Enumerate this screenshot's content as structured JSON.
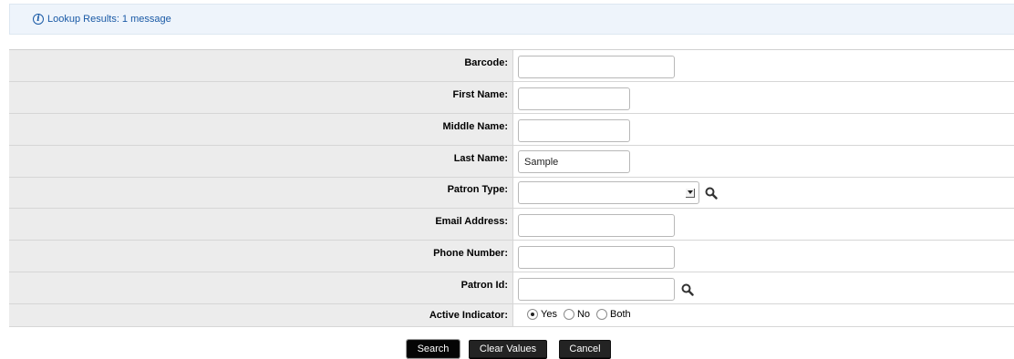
{
  "message": {
    "icon": "info-icon",
    "text": "Lookup Results: 1 message"
  },
  "form": {
    "barcode": {
      "label": "Barcode:",
      "value": ""
    },
    "first_name": {
      "label": "First Name:",
      "value": ""
    },
    "middle_name": {
      "label": "Middle Name:",
      "value": ""
    },
    "last_name": {
      "label": "Last Name:",
      "value": "Sample"
    },
    "patron_type": {
      "label": "Patron Type:",
      "value": ""
    },
    "email": {
      "label": "Email Address:",
      "value": ""
    },
    "phone": {
      "label": "Phone Number:",
      "value": ""
    },
    "patron_id": {
      "label": "Patron Id:",
      "value": ""
    },
    "active_indicator": {
      "label": "Active Indicator:",
      "options": [
        "Yes",
        "No",
        "Both"
      ],
      "selected": "Yes"
    }
  },
  "buttons": {
    "search": "Search",
    "clear": "Clear Values",
    "cancel": "Cancel"
  }
}
